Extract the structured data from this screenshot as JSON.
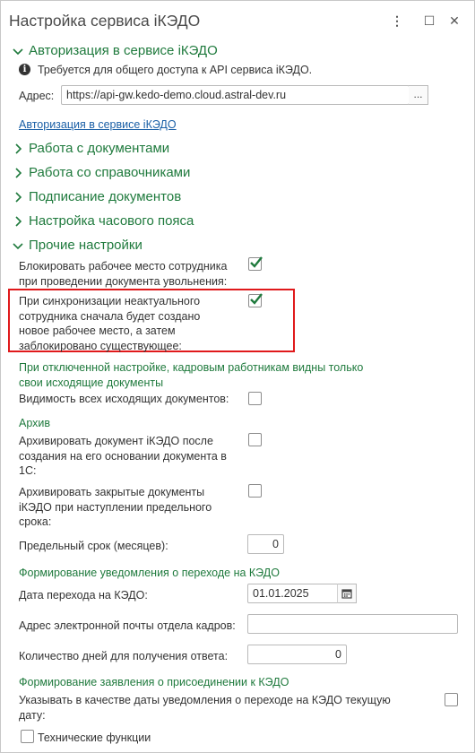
{
  "window": {
    "title": "Настройка сервиса iКЭДО",
    "menu_glyph": "⋮",
    "maximize_glyph": "☐",
    "close_glyph": "✕"
  },
  "sections": {
    "auth": {
      "title": "Авторизация в сервисе iКЭДО",
      "info_text": "Требуется для общего доступа к API сервиса iКЭДО.",
      "address_label": "Адрес:",
      "address_value": "https://api-gw.kedo-demo.cloud.astral-dev.ru",
      "dots_label": "...",
      "auth_link": "Авторизация в сервисе iКЭДО"
    },
    "documents": {
      "title": "Работа с документами"
    },
    "references": {
      "title": "Работа со справочниками"
    },
    "signing": {
      "title": "Подписание документов"
    },
    "timezone": {
      "title": "Настройка часового пояса"
    },
    "other": {
      "title": "Прочие настройки",
      "block_workplace": {
        "line1": "Блокировать рабочее место сотрудника",
        "line2": "при проведении документа увольнения:",
        "checked": true
      },
      "sync_inactive": {
        "line1": "При синхронизации неактуального",
        "line2": "сотрудника сначала будет создано",
        "line3": "новое рабочее место, а затем",
        "line4": "заблокировано существующее:",
        "checked": true
      },
      "hint": {
        "line1": "При отключенной настройке, кадровым работникам видны только",
        "line2": "свои исходящие документы"
      },
      "visibility": {
        "label": "Видимость всех исходящих документов:",
        "checked": false
      },
      "archive": {
        "title": "Архив",
        "archive_after_create": {
          "line1": "Архивировать документ iКЭДО после",
          "line2": "создания на его основании документа в",
          "line3": "1С:",
          "checked": false
        },
        "archive_closed": {
          "line1": "Архивировать закрытые документы",
          "line2": "iКЭДО при наступлении предельного",
          "line3": "срока:",
          "checked": false
        },
        "limit_label": "Предельный срок (месяцев):",
        "limit_value": "0"
      },
      "notification": {
        "title": "Формирование уведомления о переходе на КЭДО",
        "date_label": "Дата перехода на КЭДО:",
        "date_value": "01.01.2025",
        "email_label": "Адрес электронной почты отдела кадров:",
        "email_value": "",
        "days_label": "Количество дней для получения ответа:",
        "days_value": "0"
      },
      "application": {
        "title": "Формирование заявления о присоединении к КЭДО",
        "current_date_line1": "Указывать в качестве даты уведомления о переходе на КЭДО текущую",
        "current_date_line2": "дату:",
        "current_date_checked": false
      },
      "tech_functions": {
        "label": "Технические функции",
        "checked": false
      }
    }
  },
  "colors": {
    "accent_green": "#1f7a3d",
    "link_blue": "#1a5fa6",
    "highlight_red": "#e0191b"
  }
}
